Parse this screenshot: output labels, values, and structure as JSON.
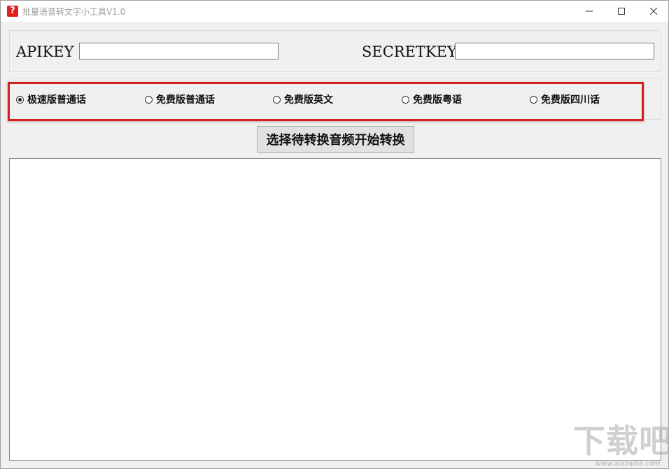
{
  "window": {
    "title": "批量语音转文字小工具V1.0",
    "icon_symbol": "?",
    "icon_color": "#e02020",
    "controls": {
      "minimize_icon": "minimize-icon",
      "maximize_icon": "maximize-icon",
      "close_icon": "close-icon"
    }
  },
  "keys": {
    "apikey_label": "APIKEY",
    "apikey_value": "",
    "secretkey_label": "SECRETKEY",
    "secretkey_value": ""
  },
  "modes": {
    "highlight_color": "#d22020",
    "options": [
      {
        "label": "极速版普通话",
        "checked": true
      },
      {
        "label": "免费版普通话",
        "checked": false
      },
      {
        "label": "免费版英文",
        "checked": false
      },
      {
        "label": "免费版粤语",
        "checked": false
      },
      {
        "label": "免费版四川话",
        "checked": false
      }
    ]
  },
  "actions": {
    "convert_label": "选择待转换音频开始转换"
  },
  "output": {
    "text": ""
  },
  "watermark": {
    "text": "下载吧",
    "sub": "www.xiazaiba.com"
  }
}
